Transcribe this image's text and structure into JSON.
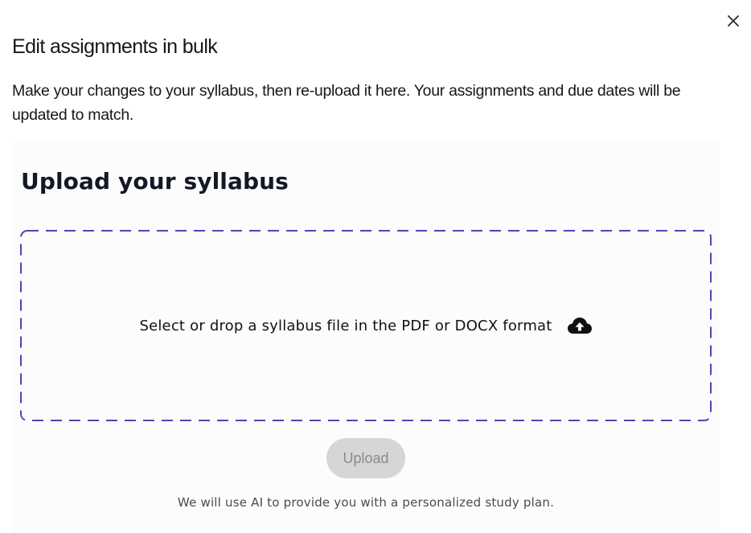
{
  "modal": {
    "title": "Edit assignments in bulk",
    "description": "Make your changes to your syllabus, then re-upload  it here. Your assignments and due dates will be updated to match.",
    "close_icon": "close-icon"
  },
  "upload": {
    "heading": "Upload your syllabus",
    "dropzone_text": "Select or drop a syllabus file in the PDF or DOCX format",
    "dropzone_icon": "cloud-upload-icon",
    "button_label": "Upload",
    "button_state": "disabled",
    "footnote": "We will use AI to provide you with a personalized study plan."
  },
  "colors": {
    "dropzone_border": "#5a3fb5",
    "button_bg_disabled": "#d6d6d6",
    "button_text_disabled": "#8a8a8a",
    "panel_bg": "#fcfcfc"
  }
}
